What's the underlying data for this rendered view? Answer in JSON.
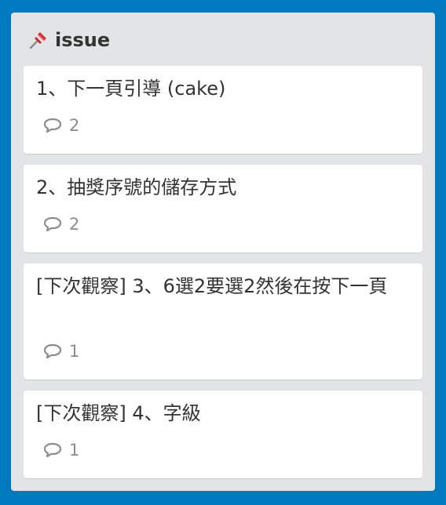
{
  "list": {
    "title": "issue",
    "pin_icon": "pushpin-icon",
    "cards": [
      {
        "title": "1、下一頁引導 (cake)",
        "comments": "2"
      },
      {
        "title": "2、抽獎序號的儲存方式",
        "comments": "2"
      },
      {
        "title": "[下次觀察] 3、6選2要選2然後在按下一頁",
        "comments": "1"
      },
      {
        "title": "[下次觀察] 4、字級",
        "comments": "1"
      }
    ]
  },
  "colors": {
    "board_background": "#0079bf",
    "list_background": "#e2e4e6",
    "card_background": "#ffffff",
    "badge_text": "#8c8c8c"
  },
  "icons": {
    "comment_icon": "speech-bubble-icon"
  }
}
